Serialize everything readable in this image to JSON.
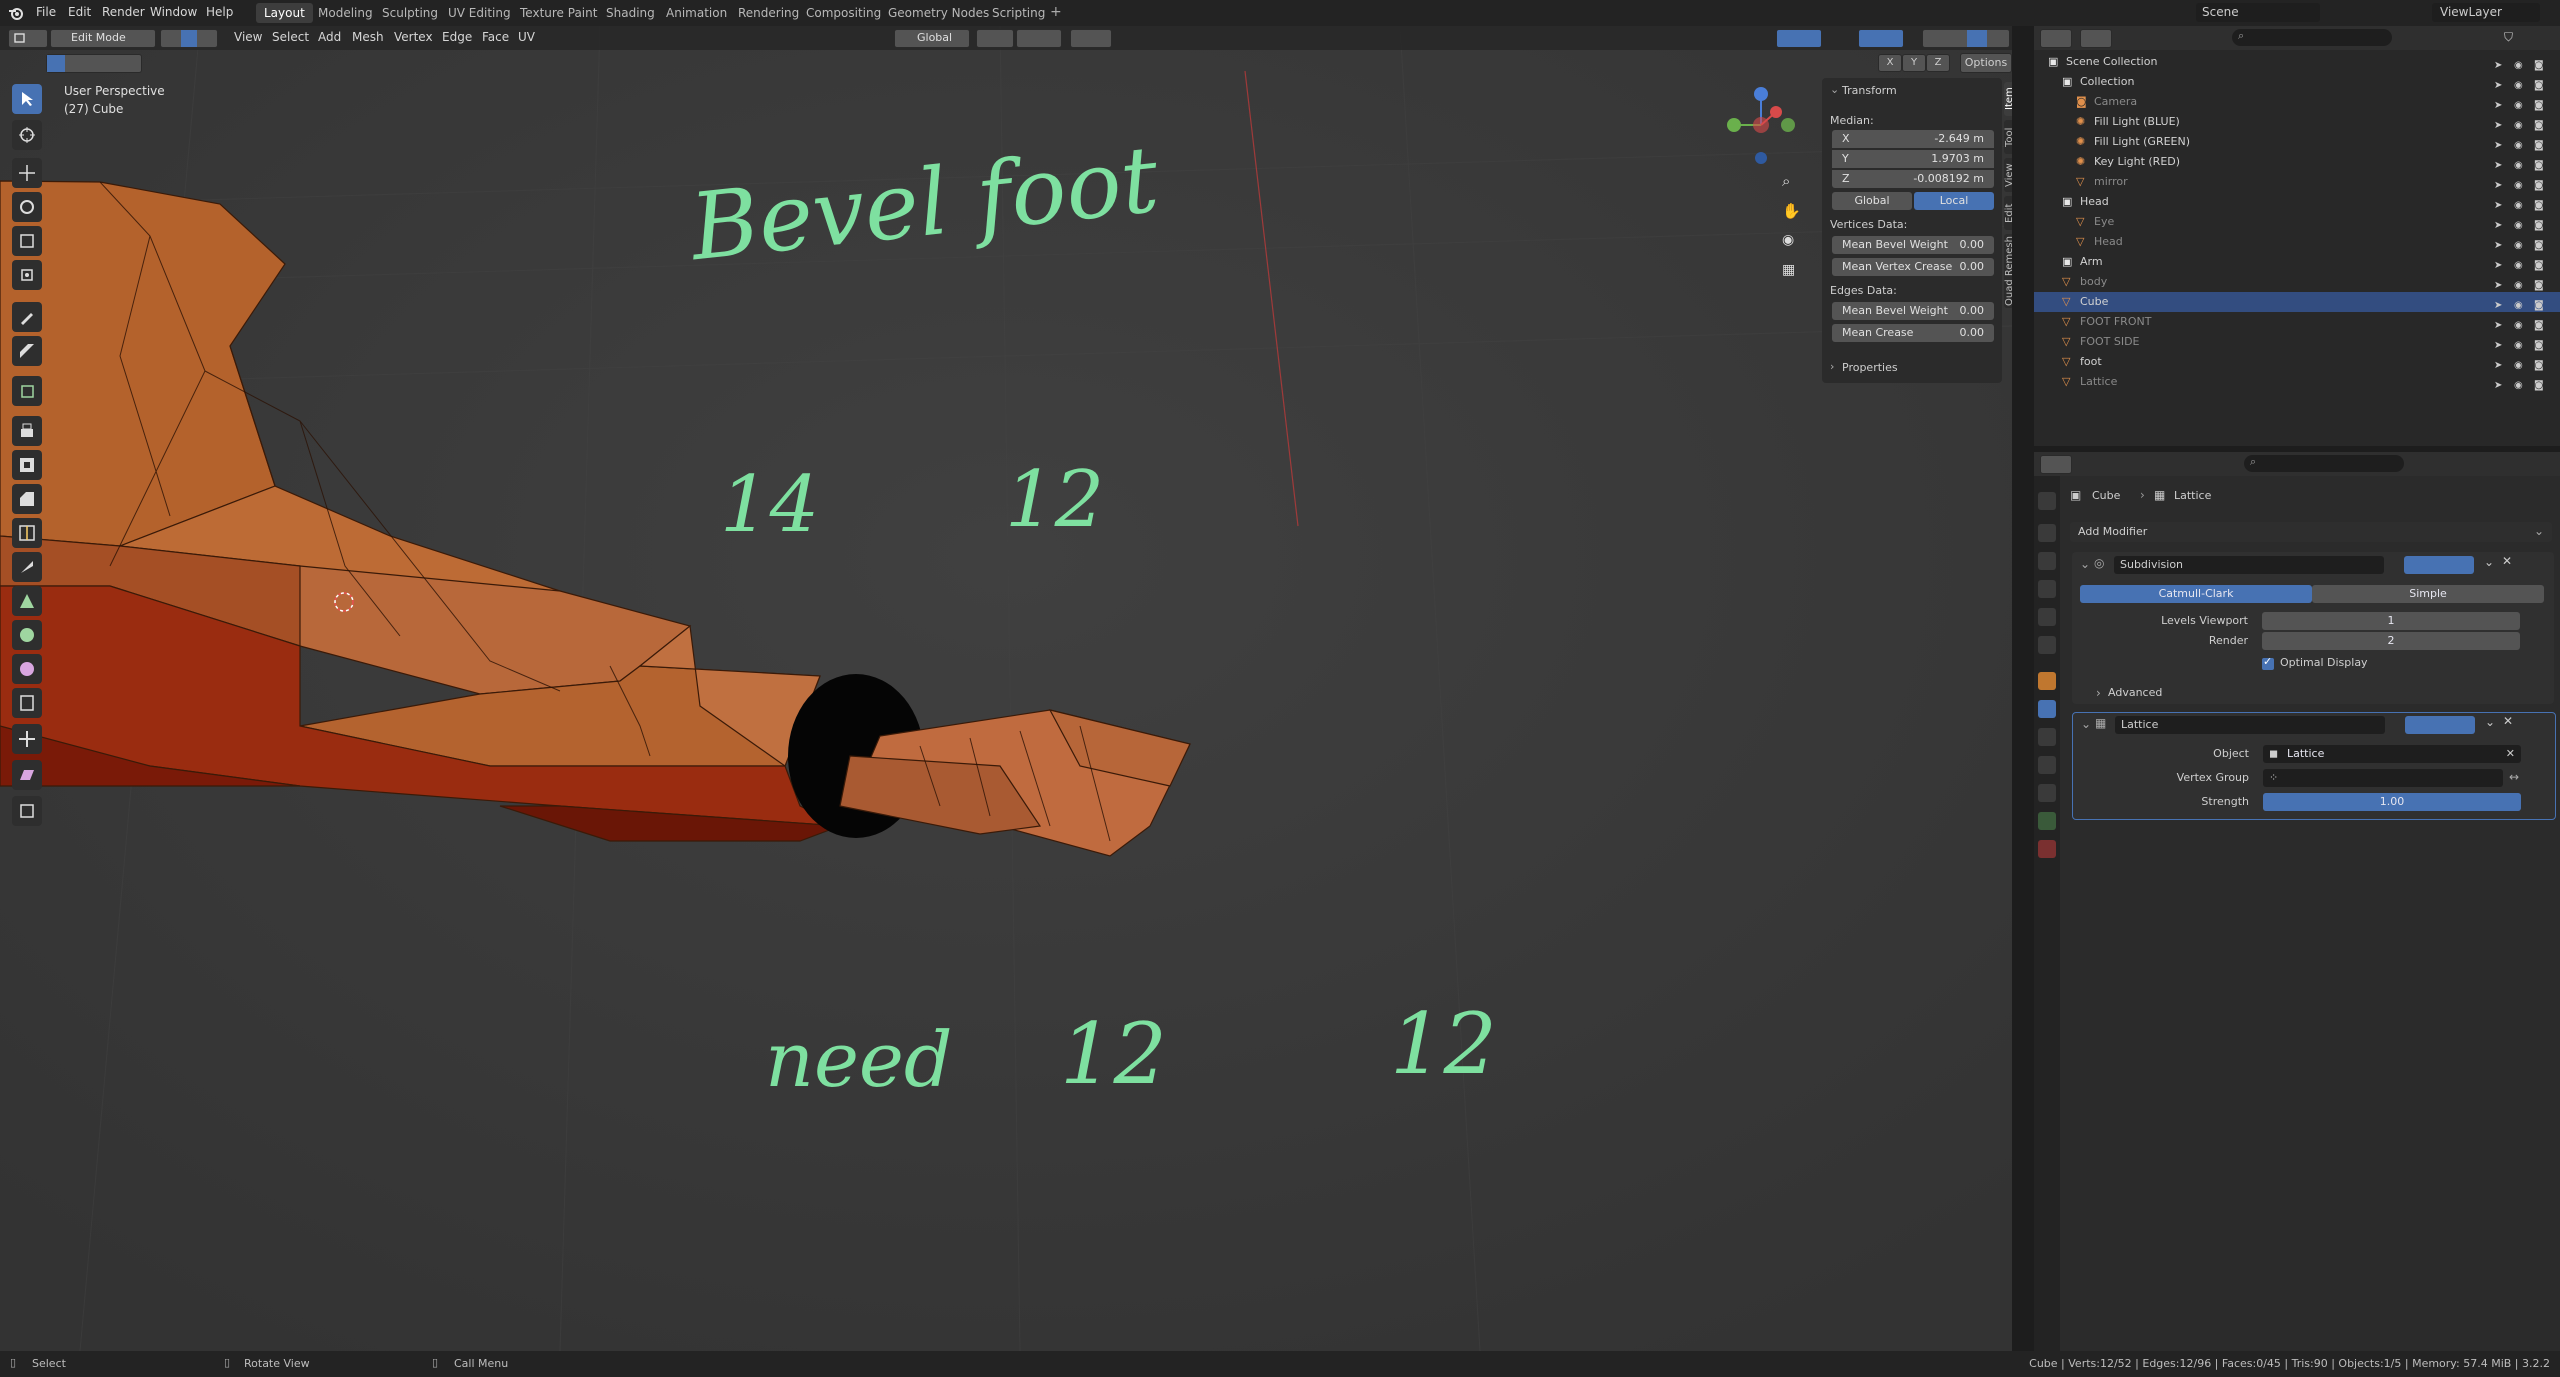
{
  "app": {
    "name": "Blender",
    "logo_icon": "blender-logo-icon"
  },
  "top_menu": [
    "File",
    "Edit",
    "Render",
    "Window",
    "Help"
  ],
  "workspaces": [
    "Layout",
    "Modeling",
    "Sculpting",
    "UV Editing",
    "Texture Paint",
    "Shading",
    "Animation",
    "Rendering",
    "Compositing",
    "Geometry Nodes",
    "Scripting"
  ],
  "active_workspace": "Layout",
  "scene": {
    "label": "Scene",
    "view_layer": "ViewLayer"
  },
  "viewport": {
    "mode": "Edit Mode",
    "menus": [
      "View",
      "Select",
      "Add",
      "Mesh",
      "Vertex",
      "Edge",
      "Face",
      "UV"
    ],
    "orientation": "Global",
    "options_label": "Options",
    "axis_buttons": [
      "X",
      "Y",
      "Z"
    ],
    "info_line1": "User Perspective",
    "info_line2": "(27) Cube",
    "handwriting": {
      "title": "Bevel foot",
      "n1": "14",
      "n2": "12",
      "need": "need",
      "n3": "12",
      "n4": "12"
    }
  },
  "npanel": {
    "tabs": [
      "Item",
      "Tool",
      "View",
      "Edit",
      "Quad Remesh"
    ],
    "transform_label": "Transform",
    "median_label": "Median:",
    "x": {
      "label": "X",
      "value": "-2.649 m"
    },
    "y": {
      "label": "Y",
      "value": "1.9703 m"
    },
    "z": {
      "label": "Z",
      "value": "-0.008192 m"
    },
    "global_btn": "Global",
    "local_btn": "Local",
    "vertices_data": "Vertices Data:",
    "v_bevel": {
      "label": "Mean Bevel Weight",
      "value": "0.00"
    },
    "v_crease": {
      "label": "Mean Vertex Crease",
      "value": "0.00"
    },
    "edges_data": "Edges Data:",
    "e_bevel": {
      "label": "Mean Bevel Weight",
      "value": "0.00"
    },
    "e_crease": {
      "label": "Mean Crease",
      "value": "0.00"
    },
    "properties_label": "Properties"
  },
  "outliner": {
    "rows": [
      {
        "name": "Scene Collection",
        "indent": 0,
        "icon": "collection-icon",
        "dim": false,
        "selected": false
      },
      {
        "name": "Collection",
        "indent": 1,
        "icon": "collection-icon",
        "dim": false,
        "selected": false
      },
      {
        "name": "Camera",
        "indent": 2,
        "icon": "camera-icon",
        "dim": true,
        "selected": false
      },
      {
        "name": "Fill Light (BLUE)",
        "indent": 2,
        "icon": "light-icon",
        "dim": false,
        "selected": false
      },
      {
        "name": "Fill Light (GREEN)",
        "indent": 2,
        "icon": "light-icon",
        "dim": false,
        "selected": false
      },
      {
        "name": "Key Light (RED)",
        "indent": 2,
        "icon": "light-icon",
        "dim": false,
        "selected": false
      },
      {
        "name": "mirror",
        "indent": 2,
        "icon": "empty-icon",
        "dim": true,
        "selected": false
      },
      {
        "name": "Head",
        "indent": 1,
        "icon": "collection-icon",
        "dim": false,
        "selected": false
      },
      {
        "name": "Eye",
        "indent": 2,
        "icon": "mesh-icon",
        "dim": true,
        "selected": false
      },
      {
        "name": "Head",
        "indent": 2,
        "icon": "mesh-icon",
        "dim": true,
        "selected": false
      },
      {
        "name": "Arm",
        "indent": 1,
        "icon": "collection-icon",
        "dim": false,
        "selected": false
      },
      {
        "name": "body",
        "indent": 1,
        "icon": "mesh-icon",
        "dim": true,
        "selected": false
      },
      {
        "name": "Cube",
        "indent": 1,
        "icon": "mesh-icon",
        "dim": false,
        "selected": true
      },
      {
        "name": "FOOT FRONT",
        "indent": 1,
        "icon": "image-icon",
        "dim": true,
        "selected": false
      },
      {
        "name": "FOOT SIDE",
        "indent": 1,
        "icon": "image-icon",
        "dim": true,
        "selected": false
      },
      {
        "name": "foot",
        "indent": 1,
        "icon": "mesh-icon",
        "dim": false,
        "selected": false
      },
      {
        "name": "Lattice",
        "indent": 1,
        "icon": "lattice-icon",
        "dim": true,
        "selected": false
      }
    ]
  },
  "properties": {
    "breadcrumb_object": "Cube",
    "breadcrumb_modifier": "Lattice",
    "add_modifier": "Add Modifier",
    "subdivision": {
      "name": "Subdivision",
      "catmull": "Catmull-Clark",
      "simple": "Simple",
      "levels_label": "Levels Viewport",
      "levels_value": "1",
      "render_label": "Render",
      "render_value": "2",
      "optimal": "Optimal Display",
      "advanced": "Advanced"
    },
    "lattice": {
      "name": "Lattice",
      "object_label": "Object",
      "object_value": "Lattice",
      "vgroup_label": "Vertex Group",
      "strength_label": "Strength",
      "strength_value": "1.00",
      "strength_fraction": 1.0
    }
  },
  "statusbar": {
    "select": "Select",
    "rotate": "Rotate View",
    "call_menu": "Call Menu",
    "stats": "Cube | Verts:12/52 | Edges:12/96 | Faces:0/45 | Tris:90 | Objects:1/5 | Memory: 57.4 MiB | 3.2.2"
  },
  "colors": {
    "accent": "#4772b3",
    "mesh": "#b86a3a",
    "mesh_dark": "#8a2a10",
    "handwriting": "#7ee0a0"
  }
}
